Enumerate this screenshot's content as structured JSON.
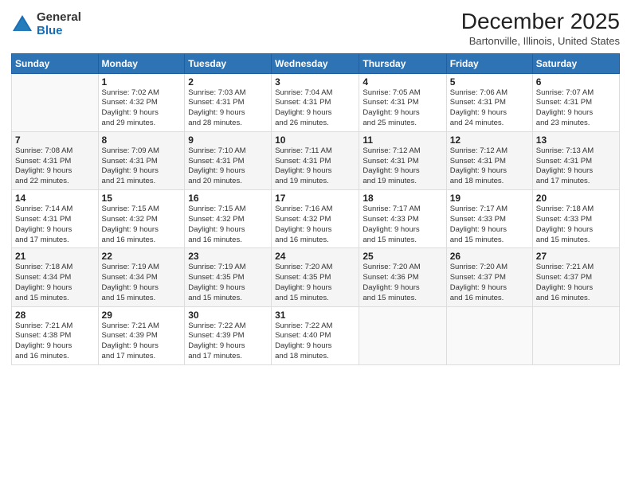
{
  "logo": {
    "general": "General",
    "blue": "Blue"
  },
  "header": {
    "title": "December 2025",
    "subtitle": "Bartonville, Illinois, United States"
  },
  "days_of_week": [
    "Sunday",
    "Monday",
    "Tuesday",
    "Wednesday",
    "Thursday",
    "Friday",
    "Saturday"
  ],
  "weeks": [
    [
      {
        "day": "",
        "info": ""
      },
      {
        "day": "1",
        "info": "Sunrise: 7:02 AM\nSunset: 4:32 PM\nDaylight: 9 hours\nand 29 minutes."
      },
      {
        "day": "2",
        "info": "Sunrise: 7:03 AM\nSunset: 4:31 PM\nDaylight: 9 hours\nand 28 minutes."
      },
      {
        "day": "3",
        "info": "Sunrise: 7:04 AM\nSunset: 4:31 PM\nDaylight: 9 hours\nand 26 minutes."
      },
      {
        "day": "4",
        "info": "Sunrise: 7:05 AM\nSunset: 4:31 PM\nDaylight: 9 hours\nand 25 minutes."
      },
      {
        "day": "5",
        "info": "Sunrise: 7:06 AM\nSunset: 4:31 PM\nDaylight: 9 hours\nand 24 minutes."
      },
      {
        "day": "6",
        "info": "Sunrise: 7:07 AM\nSunset: 4:31 PM\nDaylight: 9 hours\nand 23 minutes."
      }
    ],
    [
      {
        "day": "7",
        "info": "Sunrise: 7:08 AM\nSunset: 4:31 PM\nDaylight: 9 hours\nand 22 minutes."
      },
      {
        "day": "8",
        "info": "Sunrise: 7:09 AM\nSunset: 4:31 PM\nDaylight: 9 hours\nand 21 minutes."
      },
      {
        "day": "9",
        "info": "Sunrise: 7:10 AM\nSunset: 4:31 PM\nDaylight: 9 hours\nand 20 minutes."
      },
      {
        "day": "10",
        "info": "Sunrise: 7:11 AM\nSunset: 4:31 PM\nDaylight: 9 hours\nand 19 minutes."
      },
      {
        "day": "11",
        "info": "Sunrise: 7:12 AM\nSunset: 4:31 PM\nDaylight: 9 hours\nand 19 minutes."
      },
      {
        "day": "12",
        "info": "Sunrise: 7:12 AM\nSunset: 4:31 PM\nDaylight: 9 hours\nand 18 minutes."
      },
      {
        "day": "13",
        "info": "Sunrise: 7:13 AM\nSunset: 4:31 PM\nDaylight: 9 hours\nand 17 minutes."
      }
    ],
    [
      {
        "day": "14",
        "info": "Sunrise: 7:14 AM\nSunset: 4:31 PM\nDaylight: 9 hours\nand 17 minutes."
      },
      {
        "day": "15",
        "info": "Sunrise: 7:15 AM\nSunset: 4:32 PM\nDaylight: 9 hours\nand 16 minutes."
      },
      {
        "day": "16",
        "info": "Sunrise: 7:15 AM\nSunset: 4:32 PM\nDaylight: 9 hours\nand 16 minutes."
      },
      {
        "day": "17",
        "info": "Sunrise: 7:16 AM\nSunset: 4:32 PM\nDaylight: 9 hours\nand 16 minutes."
      },
      {
        "day": "18",
        "info": "Sunrise: 7:17 AM\nSunset: 4:33 PM\nDaylight: 9 hours\nand 15 minutes."
      },
      {
        "day": "19",
        "info": "Sunrise: 7:17 AM\nSunset: 4:33 PM\nDaylight: 9 hours\nand 15 minutes."
      },
      {
        "day": "20",
        "info": "Sunrise: 7:18 AM\nSunset: 4:33 PM\nDaylight: 9 hours\nand 15 minutes."
      }
    ],
    [
      {
        "day": "21",
        "info": "Sunrise: 7:18 AM\nSunset: 4:34 PM\nDaylight: 9 hours\nand 15 minutes."
      },
      {
        "day": "22",
        "info": "Sunrise: 7:19 AM\nSunset: 4:34 PM\nDaylight: 9 hours\nand 15 minutes."
      },
      {
        "day": "23",
        "info": "Sunrise: 7:19 AM\nSunset: 4:35 PM\nDaylight: 9 hours\nand 15 minutes."
      },
      {
        "day": "24",
        "info": "Sunrise: 7:20 AM\nSunset: 4:35 PM\nDaylight: 9 hours\nand 15 minutes."
      },
      {
        "day": "25",
        "info": "Sunrise: 7:20 AM\nSunset: 4:36 PM\nDaylight: 9 hours\nand 15 minutes."
      },
      {
        "day": "26",
        "info": "Sunrise: 7:20 AM\nSunset: 4:37 PM\nDaylight: 9 hours\nand 16 minutes."
      },
      {
        "day": "27",
        "info": "Sunrise: 7:21 AM\nSunset: 4:37 PM\nDaylight: 9 hours\nand 16 minutes."
      }
    ],
    [
      {
        "day": "28",
        "info": "Sunrise: 7:21 AM\nSunset: 4:38 PM\nDaylight: 9 hours\nand 16 minutes."
      },
      {
        "day": "29",
        "info": "Sunrise: 7:21 AM\nSunset: 4:39 PM\nDaylight: 9 hours\nand 17 minutes."
      },
      {
        "day": "30",
        "info": "Sunrise: 7:22 AM\nSunset: 4:39 PM\nDaylight: 9 hours\nand 17 minutes."
      },
      {
        "day": "31",
        "info": "Sunrise: 7:22 AM\nSunset: 4:40 PM\nDaylight: 9 hours\nand 18 minutes."
      },
      {
        "day": "",
        "info": ""
      },
      {
        "day": "",
        "info": ""
      },
      {
        "day": "",
        "info": ""
      }
    ]
  ]
}
